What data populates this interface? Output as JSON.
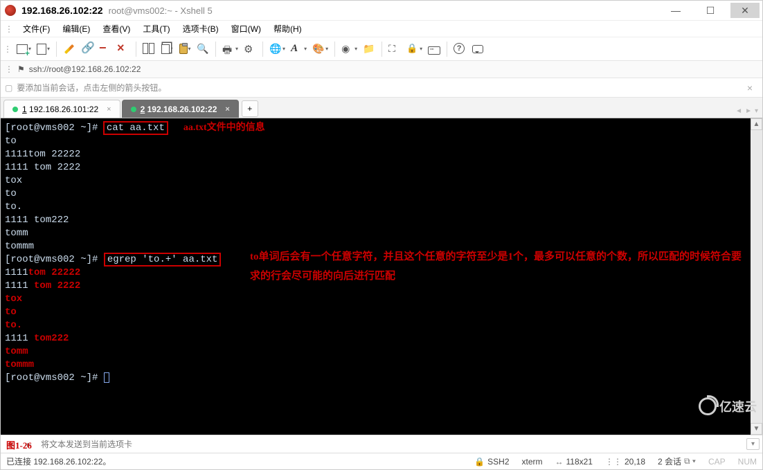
{
  "title": {
    "ip": "192.168.26.102:22",
    "sub": "root@vms002:~ - Xshell 5"
  },
  "menu": {
    "file": "文件(F)",
    "edit": "编辑(E)",
    "view": "查看(V)",
    "tools": "工具(T)",
    "tabs": "选项卡(B)",
    "window": "窗口(W)",
    "help": "帮助(H)"
  },
  "addressbar": {
    "url": "ssh://root@192.168.26.102:22"
  },
  "hint": {
    "text": "要添加当前会话，点击左侧的箭头按钮。"
  },
  "tabs": [
    {
      "num": "1",
      "label": "192.168.26.101:22",
      "active": false
    },
    {
      "num": "2",
      "label": "192.168.26.102:22",
      "active": true
    }
  ],
  "terminal": {
    "prompt": "[root@vms002 ~]#",
    "cmd1": "cat aa.txt",
    "annot1": "aa.txt文件中的信息",
    "cat_output": [
      "to",
      "1111tom 22222",
      "1111 tom 2222",
      "tox",
      "to",
      "to.",
      "1111 tom222",
      "tomm",
      "tommm"
    ],
    "cmd2": "egrep 'to.+' aa.txt",
    "annot2": "to单词后会有一个任意字符，并且这个任意的字符至少是1个，最多可以任意的个数，所以匹配的时候符合要求的行会尽可能的向后进行匹配",
    "egrep_output": [
      {
        "pre": "1111",
        "match": "tom 22222"
      },
      {
        "pre": "1111 ",
        "match": "tom 2222"
      },
      {
        "pre": "",
        "match": "tox"
      },
      {
        "pre": "",
        "match": "to "
      },
      {
        "pre": "",
        "match": "to."
      },
      {
        "pre": "1111 ",
        "match": "tom222"
      },
      {
        "pre": "",
        "match": "tomm"
      },
      {
        "pre": "",
        "match": "tommm"
      }
    ]
  },
  "figure_label": "图1-26",
  "sendbar": {
    "placeholder": "将文本发送到当前选项卡"
  },
  "status": {
    "connected": "已连接 192.168.26.102:22。",
    "proto": "SSH2",
    "term": "xterm",
    "size": "118x21",
    "pos": "20,18",
    "sessions_label": "2 会话",
    "cap": "CAP",
    "num": "NUM"
  },
  "watermark": "亿速云"
}
